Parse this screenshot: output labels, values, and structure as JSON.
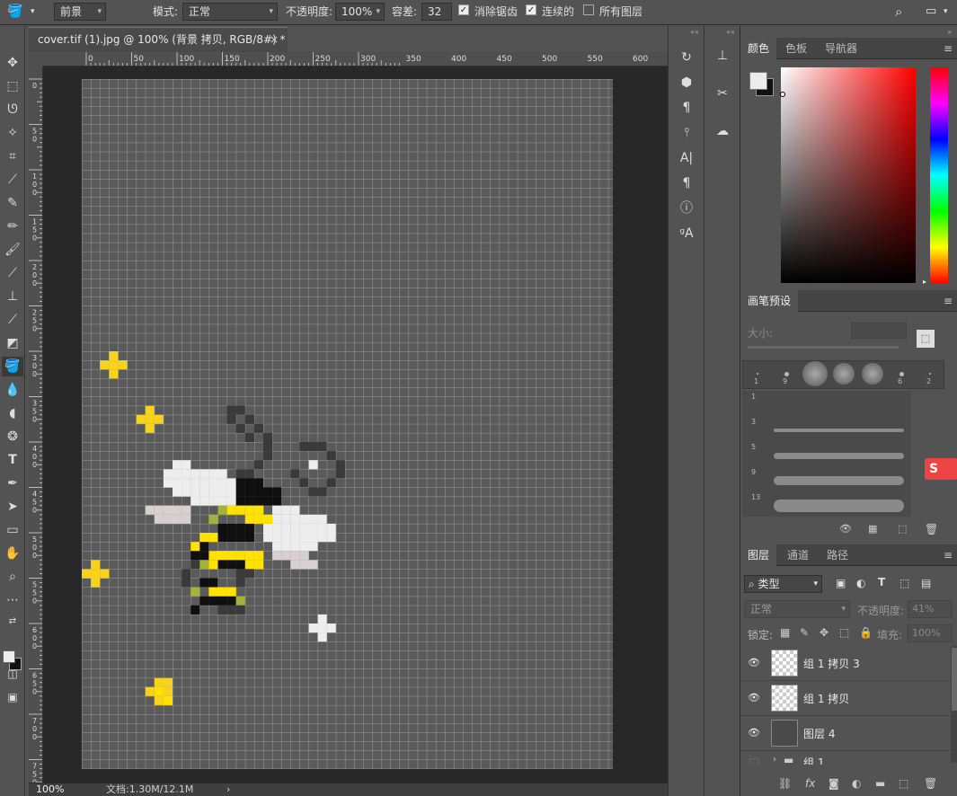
{
  "options_bar": {
    "fill_source_value": "前景",
    "mode_label": "模式:",
    "mode_value": "正常",
    "opacity_label": "不透明度:",
    "opacity_value": "100%",
    "tolerance_label": "容差:",
    "tolerance_value": "32",
    "antialias_label": "消除锯齿",
    "antialias_checked": true,
    "contiguous_label": "连续的",
    "contiguous_checked": true,
    "all_layers_label": "所有图层",
    "all_layers_checked": false
  },
  "document": {
    "tab_title": "cover.tif (1).jpg @ 100% (背景 拷贝, RGB/8#) *",
    "ruler_top_labels": [
      "0",
      "50",
      "100",
      "150",
      "200",
      "250",
      "300",
      "350",
      "400",
      "450",
      "500",
      "550",
      "600"
    ],
    "ruler_left_labels": [
      "0",
      "5 0",
      "1 0 0",
      "1 5 0",
      "2 0 0",
      "2 5 0",
      "3 0 0",
      "3 5 0",
      "4 0 0",
      "4 5 0",
      "5 0 0",
      "5 5 0",
      "6 0 0",
      "6 5 0",
      "7 0 0",
      "7 5 0"
    ],
    "zoom": "100%",
    "doc_info": "文档:1.30M/12.1M"
  },
  "color_panel": {
    "tabs": [
      "颜色",
      "色板",
      "导航器"
    ],
    "foreground_color": "#ececec",
    "background_color": "#111111"
  },
  "brush_panel": {
    "title": "画笔预设",
    "size_label": "大小:",
    "tip_sizes": [
      "1",
      "9",
      "",
      "",
      "",
      "6",
      "2"
    ],
    "stroke_sizes": [
      "1",
      "3",
      "5",
      "9",
      "13"
    ]
  },
  "layers_panel": {
    "tabs": [
      "图层",
      "通道",
      "路径"
    ],
    "filter_value": "类型",
    "blend_mode": "正常",
    "opacity_label": "不透明度:",
    "opacity_value": "41%",
    "lock_label": "锁定:",
    "fill_label": "填充:",
    "fill_value": "100%",
    "layers": [
      {
        "name": "组 1 拷贝 3",
        "visible": true
      },
      {
        "name": "组 1 拷贝",
        "visible": true
      },
      {
        "name": "图层 4",
        "visible": true
      },
      {
        "name": "组 1",
        "visible": false
      }
    ]
  },
  "tools": [
    "move-tool",
    "marquee-tool",
    "lasso-tool",
    "magic-wand-tool",
    "crop-tool",
    "eyedropper-tool",
    "healing-brush-tool",
    "brush-tool",
    "clone-stamp-tool",
    "history-brush-tool",
    "eraser-tool",
    "paint-bucket-tool",
    "blur-tool",
    "dodge-tool",
    "pen-tool",
    "type-tool",
    "path-selection-tool",
    "rectangle-tool",
    "hand-tool",
    "zoom-tool",
    "more-tools"
  ]
}
